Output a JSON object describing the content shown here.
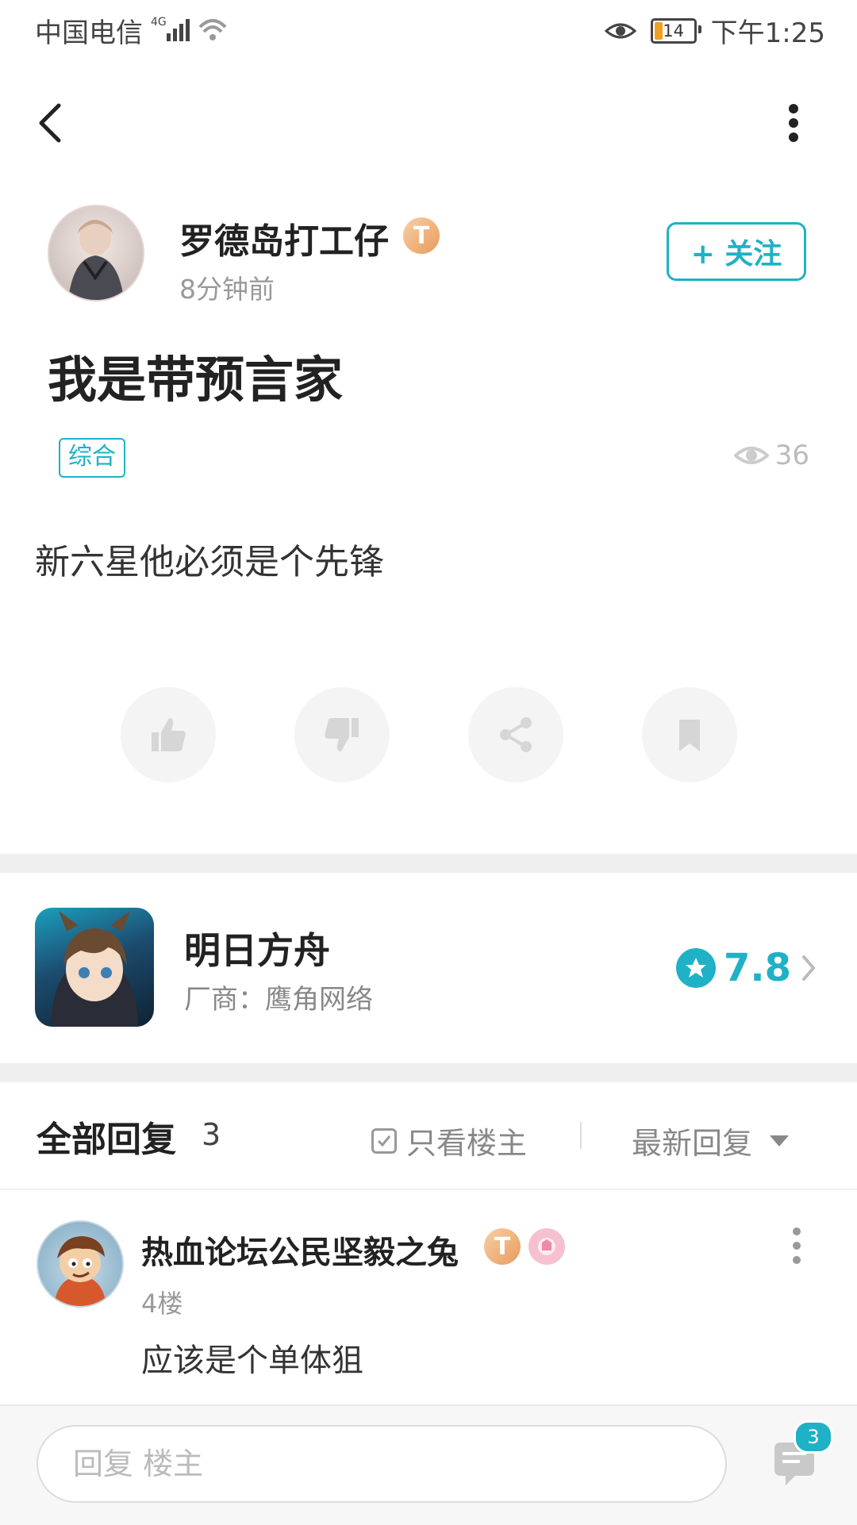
{
  "status_bar": {
    "carrier": "中国电信",
    "network": "4G",
    "battery": "14",
    "time": "下午1:25"
  },
  "post": {
    "author": "罗德岛打工仔",
    "author_badge": "T",
    "time": "8分钟前",
    "follow_label": "+ 关注",
    "title": "我是带预言家",
    "tag": "综合",
    "views": "36",
    "body": "新六星他必须是个先锋",
    "actions": [
      "like",
      "dislike",
      "share",
      "bookmark"
    ]
  },
  "game": {
    "name": "明日方舟",
    "vendor": "厂商：鹰角网络",
    "rating": "7.8"
  },
  "replies": {
    "title": "全部回复",
    "count": "3",
    "only_op_label": "只看楼主",
    "sort_label": "最新回复",
    "items": [
      {
        "name": "热血论坛公民坚毅之兔",
        "badge": "T",
        "floor": "4楼",
        "text": "应该是个单体狙"
      }
    ]
  },
  "bottom_bar": {
    "reply_placeholder": "回复  楼主",
    "comment_count": "3"
  },
  "colors": {
    "accent": "#1fb1c6",
    "divider": "#efefef"
  }
}
